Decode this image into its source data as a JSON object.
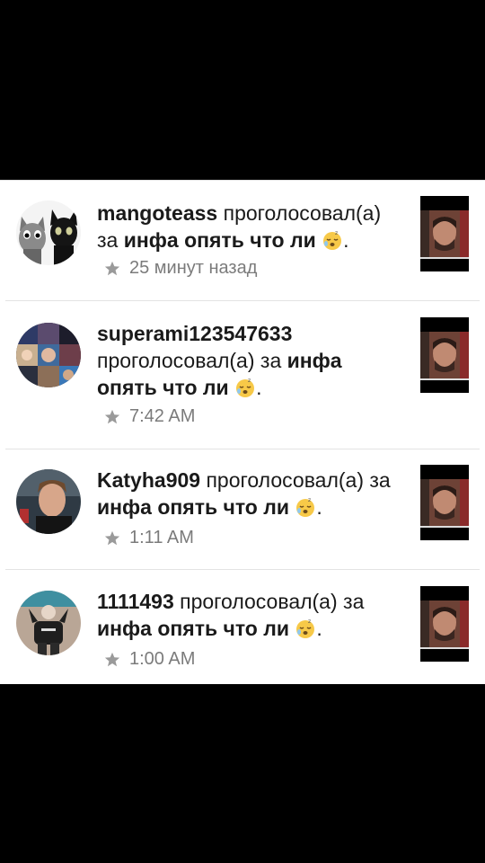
{
  "notifications": [
    {
      "username": "mangoteass",
      "action": "проголосовал(а) за",
      "post": "инфа опять что ли",
      "time": "25 минут назад",
      "avatar_icon": "cats-avatar"
    },
    {
      "username": "superami123547633",
      "action": "проголосовал(а) за",
      "post": "инфа опять что ли",
      "time": "7:42 AM",
      "avatar_icon": "collage-avatar"
    },
    {
      "username": "Katyha909",
      "action": "проголосовал(а) за",
      "post": "инфа опять что ли",
      "time": "1:11 AM",
      "avatar_icon": "portrait-avatar"
    },
    {
      "username": "1111493",
      "action": "проголосовал(а) за",
      "post": "инфа опять что ли",
      "time": "1:00 AM",
      "avatar_icon": "person-avatar"
    }
  ],
  "emoji": "sleepy-face-icon",
  "colors": {
    "background": "#000000",
    "panel": "#ffffff",
    "meta_text": "#7b7b7b",
    "divider": "#e3e3e3"
  }
}
